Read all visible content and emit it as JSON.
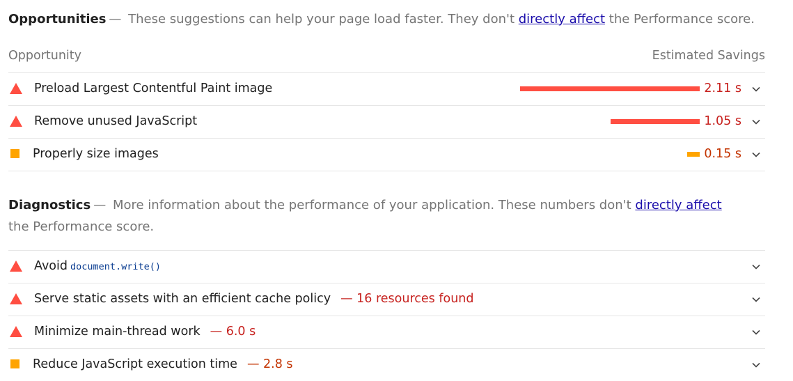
{
  "opportunities": {
    "heading": "Opportunities",
    "dash": "—",
    "desc_before": "These suggestions can help your page load faster. They don't",
    "link": "directly affect",
    "desc_after": "the Performance score.",
    "col_left": "Opportunity",
    "col_right": "Estimated Savings",
    "items": [
      {
        "title": "Preload Largest Contentful Paint image",
        "value": "2.11 s",
        "savings_seconds": 2.11,
        "severity": "fail"
      },
      {
        "title": "Remove unused JavaScript",
        "value": "1.05 s",
        "savings_seconds": 1.05,
        "severity": "fail"
      },
      {
        "title": "Properly size images",
        "value": "0.15 s",
        "savings_seconds": 0.15,
        "severity": "average"
      }
    ]
  },
  "diagnostics": {
    "heading": "Diagnostics",
    "dash": "—",
    "desc_before": "More information about the performance of your application. These numbers don't",
    "link": "directly affect",
    "desc_after": "the Performance score.",
    "items": [
      {
        "title": "Avoid",
        "code": "document.write()",
        "detail": "",
        "severity": "fail"
      },
      {
        "title": "Serve static assets with an efficient cache policy",
        "detail": "— 16 resources found",
        "severity": "fail"
      },
      {
        "title": "Minimize main-thread work",
        "detail": "— 6.0 s",
        "severity": "fail"
      },
      {
        "title": "Reduce JavaScript execution time",
        "detail": "— 2.8 s",
        "severity": "average"
      }
    ]
  },
  "colors": {
    "fail": "#ff4e42",
    "average": "#ffa400",
    "fail_text": "#c7221f",
    "average_text": "#c33300"
  },
  "icons": {
    "fail": "red-triangle-icon",
    "average": "orange-square-icon",
    "expand": "chevron-down-icon"
  }
}
